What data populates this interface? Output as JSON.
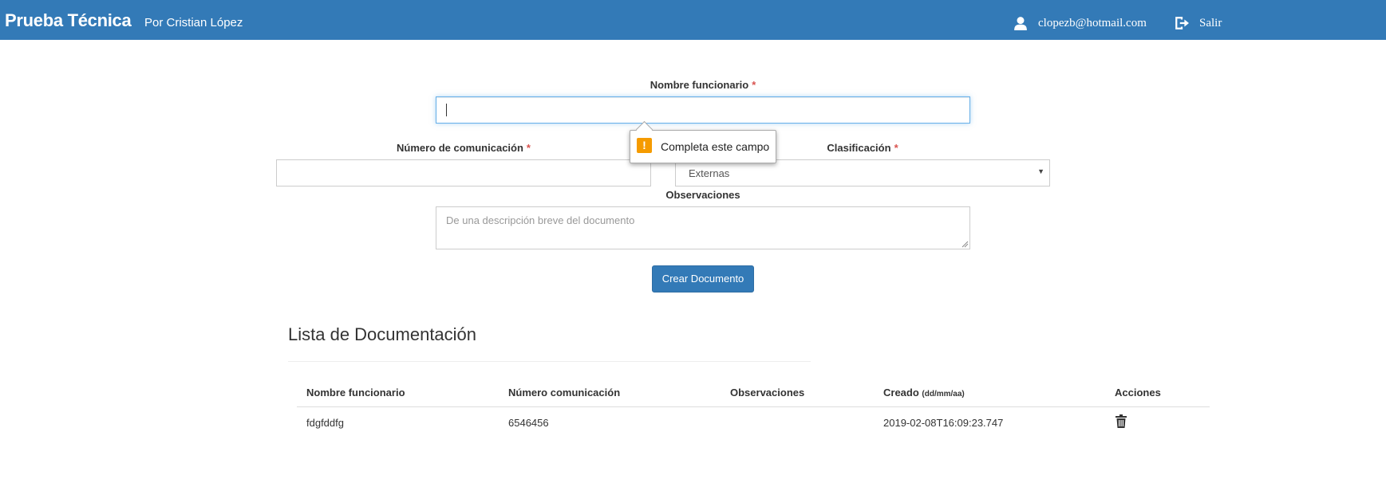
{
  "header": {
    "brand": "Prueba Técnica",
    "byline": "Por Cristian López",
    "user_email": "clopezb@hotmail.com",
    "logout_label": "Salir",
    "user_icon": "user-icon",
    "logout_icon": "logout-icon"
  },
  "form": {
    "nombre_label": "Nombre funcionario",
    "nombre_value": "",
    "numero_label": "Número de comunicación",
    "numero_value": "",
    "clasificacion_label": "Clasificación",
    "clasificacion_selected": "Externas",
    "observaciones_label": "Observaciones",
    "observaciones_placeholder": "De una descripción breve del documento",
    "required_mark": "*",
    "validation_message": "Completa este campo",
    "submit_label": "Crear Documento"
  },
  "list": {
    "title": "Lista de Documentación",
    "columns": {
      "nombre": "Nombre funcionario",
      "numero": "Número comunicación",
      "observaciones": "Observaciones",
      "creado": "Creado",
      "creado_hint": "(dd/mm/aa)",
      "acciones": "Acciones"
    },
    "rows": [
      {
        "nombre": "fdgfddfg",
        "numero": "6546456",
        "observaciones": "",
        "creado": "2019-02-08T16:09:23.747",
        "action_icon": "trash-icon"
      }
    ]
  },
  "colors": {
    "navbar": "#337ab7",
    "required": "#d9534f",
    "warning": "#f59b00"
  }
}
